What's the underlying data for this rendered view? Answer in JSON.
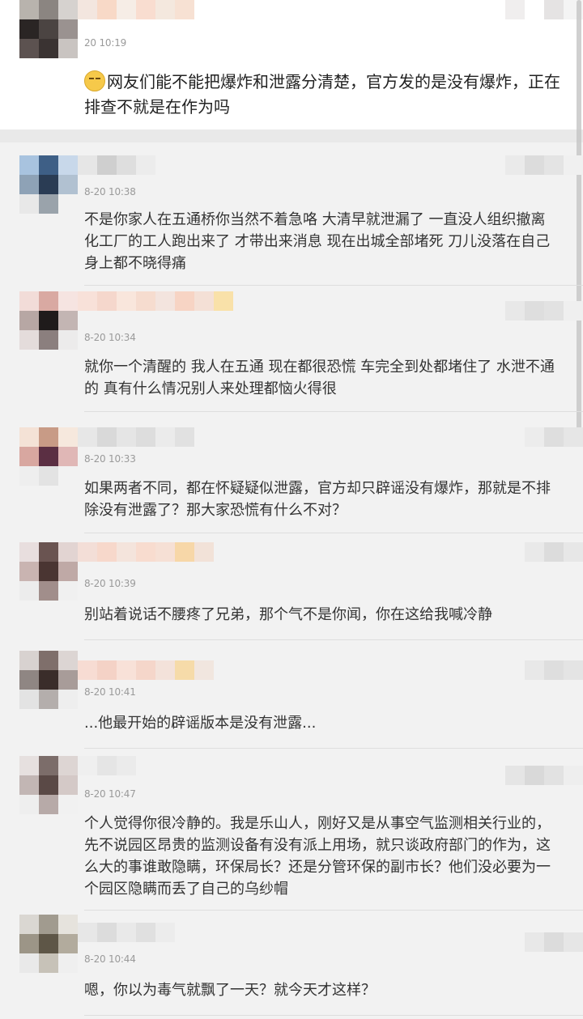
{
  "main_post": {
    "time": "20 10:19",
    "emoji": "nervous-face-icon",
    "text": "网友们能不能把爆炸和泄露分清楚，官方发的是没有爆炸，正在排查不就是在作为吗"
  },
  "comments": [
    {
      "time": "8-20 10:38",
      "text": "不是你家人在五通桥你当然不着急咯  大清早就泄漏了  一直没人组织撤离  化工厂的工人跑出来了  才带出来消息  现在出城全部堵死  刀儿没落在自己身上都不晓得痛"
    },
    {
      "time": "8-20 10:34",
      "text": "就你一个清醒的  我人在五通  现在都很恐慌  车完全到处都堵住了  水泄不通的  真有什么情况别人来处理都恼火得很"
    },
    {
      "time": "8-20 10:33",
      "text": "如果两者不同，都在怀疑疑似泄露，官方却只辟谣没有爆炸，那就是不排除没有泄露了？那大家恐慌有什么不对？"
    },
    {
      "time": "8-20 10:39",
      "text": "别站着说话不腰疼了兄弟，那个气不是你闻，你在这给我喊冷静"
    },
    {
      "time": "8-20 10:41",
      "text": "...他最开始的辟谣版本是没有泄露..."
    },
    {
      "time": "8-20 10:47",
      "text": "个人觉得你很冷静的。我是乐山人，刚好又是从事空气监测相关行业的，先不说园区昂贵的监测设备有没有派上用场，就只谈政府部门的作为，这么大的事谁敢隐瞒，环保局长？还是分管环保的副市长？他们没必要为一个园区隐瞒而丢了自己的乌纱帽"
    },
    {
      "time": "8-20 10:44",
      "text": "嗯，你以为毒气就飘了一天？就今天才这样？"
    }
  ]
}
